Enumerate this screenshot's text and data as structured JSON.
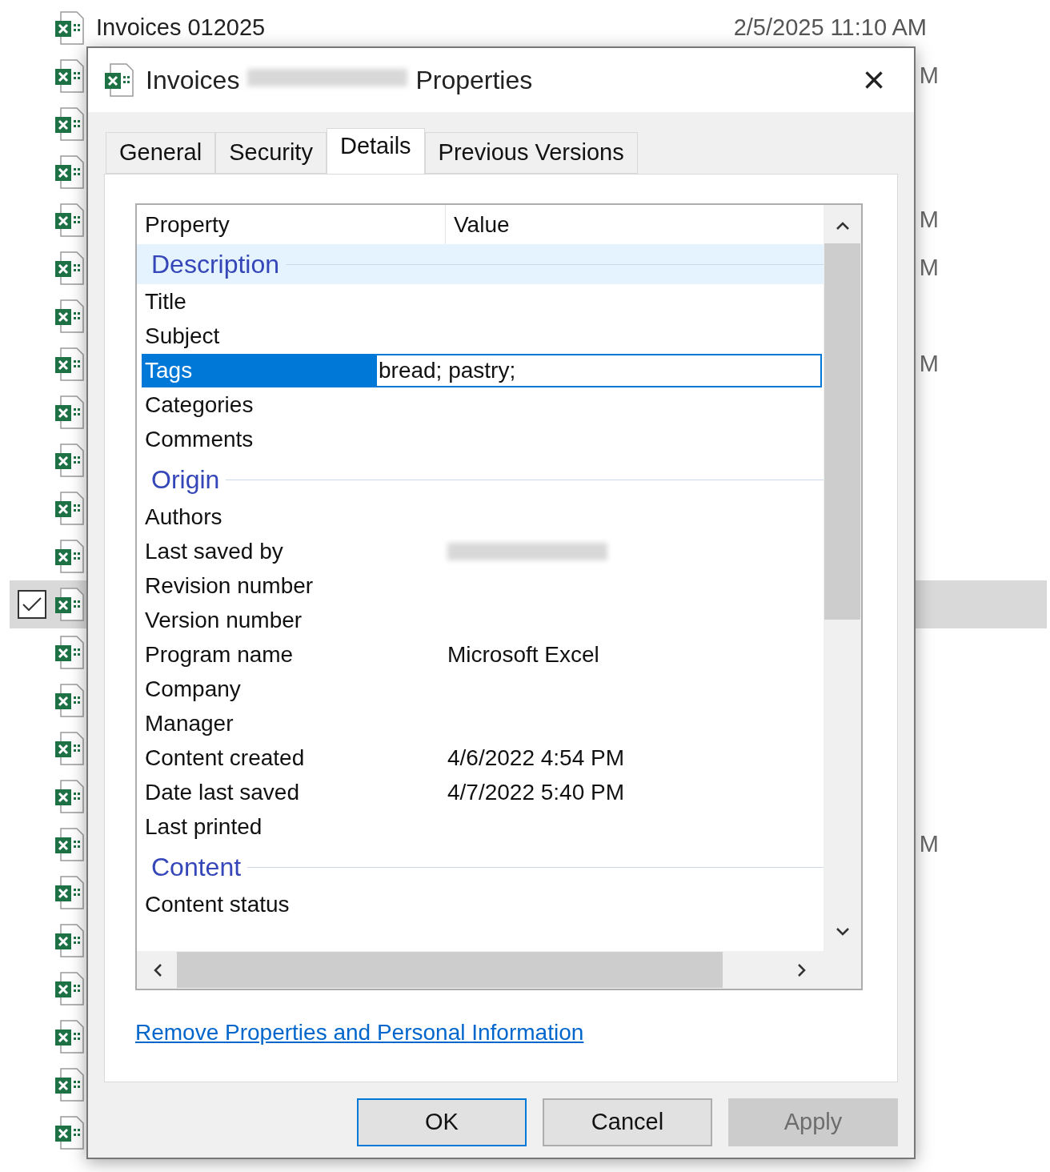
{
  "background_list": {
    "rows": [
      {
        "name": "Invoices 012025",
        "date": "2/5/2025 11:10 AM",
        "selected": false
      },
      {
        "tail": "M",
        "selected": false
      },
      {
        "selected": false
      },
      {
        "selected": false
      },
      {
        "tail": "M",
        "selected": false
      },
      {
        "tail": "M",
        "selected": false
      },
      {
        "selected": false
      },
      {
        "tail": "M",
        "selected": false
      },
      {
        "selected": false
      },
      {
        "selected": false
      },
      {
        "selected": false
      },
      {
        "selected": false
      },
      {
        "selected": true,
        "checked": true
      },
      {
        "selected": false
      },
      {
        "selected": false
      },
      {
        "selected": false
      },
      {
        "selected": false
      },
      {
        "tail": "M",
        "selected": false
      },
      {
        "selected": false
      },
      {
        "selected": false
      },
      {
        "selected": false
      },
      {
        "selected": false
      },
      {
        "selected": false
      },
      {
        "selected": false
      }
    ]
  },
  "window": {
    "title_start": "Invoices",
    "title_end": "Properties",
    "close": "×"
  },
  "tabs": [
    {
      "label": "General",
      "selected": false
    },
    {
      "label": "Security",
      "selected": false
    },
    {
      "label": "Details",
      "selected": true
    },
    {
      "label": "Previous Versions",
      "selected": false
    }
  ],
  "table": {
    "columns": [
      "Property",
      "Value"
    ],
    "rows": [
      {
        "kind": "section",
        "name": "Description",
        "selected": true
      },
      {
        "kind": "property",
        "name": "Title",
        "selected": false
      },
      {
        "kind": "property",
        "name": "Subject",
        "selected": false
      },
      {
        "kind": "property",
        "name": "Tags",
        "value": "bread; pastry;",
        "selected": true,
        "editing": true
      },
      {
        "kind": "property",
        "name": "Categories",
        "selected": false
      },
      {
        "kind": "property",
        "name": "Comments",
        "selected": false
      },
      {
        "kind": "section",
        "name": "Origin",
        "selected": false
      },
      {
        "kind": "property",
        "name": "Authors",
        "selected": false
      },
      {
        "kind": "property",
        "name": "Last saved by",
        "redacted": true,
        "selected": false
      },
      {
        "kind": "property",
        "name": "Revision number",
        "selected": false
      },
      {
        "kind": "property",
        "name": "Version number",
        "selected": false
      },
      {
        "kind": "property",
        "name": "Program name",
        "value": "Microsoft Excel",
        "selected": false
      },
      {
        "kind": "property",
        "name": "Company",
        "selected": false
      },
      {
        "kind": "property",
        "name": "Manager",
        "selected": false
      },
      {
        "kind": "property",
        "name": "Content created",
        "value": "4/6/2022 4:54 PM",
        "selected": false
      },
      {
        "kind": "property",
        "name": "Date last saved",
        "value": "4/7/2022 5:40 PM",
        "selected": false
      },
      {
        "kind": "property",
        "name": "Last printed",
        "selected": false
      },
      {
        "kind": "section",
        "name": "Content",
        "selected": false
      },
      {
        "kind": "property",
        "name": "Content status",
        "selected": false
      }
    ]
  },
  "link": "Remove Properties and Personal Information",
  "buttons": [
    {
      "label": "OK",
      "default": true,
      "disabled": false
    },
    {
      "label": "Cancel",
      "default": false,
      "disabled": false
    },
    {
      "label": "Apply",
      "default": false,
      "disabled": true
    }
  ]
}
